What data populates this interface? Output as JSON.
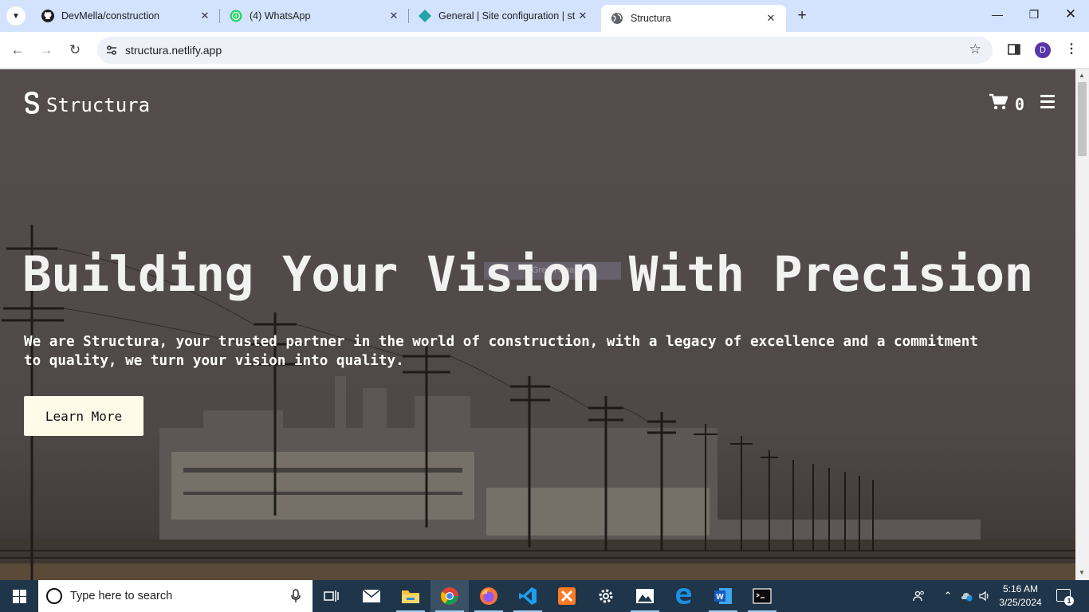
{
  "browser": {
    "tabs": [
      {
        "title": "DevMella/construction",
        "icon": "github-icon"
      },
      {
        "title": "(4) WhatsApp",
        "icon": "whatsapp-icon"
      },
      {
        "title": "General | Site configuration | st",
        "icon": "netlify-icon"
      },
      {
        "title": "Structura",
        "icon": "globe-icon",
        "active": true
      }
    ],
    "url": "structura.netlify.app",
    "profile_initial": "D"
  },
  "site": {
    "brand": "Structura",
    "cart_count": "0",
    "hero": {
      "title": "Building Your Vision With Precision",
      "ghost_text": "Green Snap",
      "subtitle": "We are Structura, your trusted partner in the world of construction, with a legacy of excellence and a commitment to quality, we turn your vision into quality.",
      "button": "Learn More"
    },
    "colors": {
      "overlay": "#544c4c",
      "button_bg": "#fffbe8"
    }
  },
  "taskbar": {
    "search_placeholder": "Type here to search",
    "apps": [
      "task-view-icon",
      "mail-icon",
      "file-explorer-icon",
      "chrome-icon",
      "firefox-icon",
      "vscode-icon",
      "xampp-icon",
      "settings-icon",
      "photos-icon",
      "edge-icon",
      "word-icon",
      "terminal-icon"
    ],
    "time": "5:16 AM",
    "date": "3/25/2024",
    "notification_count": "1"
  }
}
